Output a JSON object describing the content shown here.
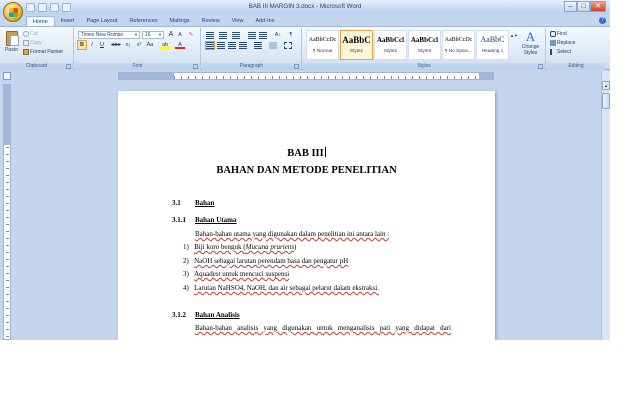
{
  "window": {
    "title": "BAB III MARGIN 3.docx - Microsoft Word",
    "controls": {
      "minimize": "–",
      "maximize": "□",
      "close": "✕"
    }
  },
  "tabs": [
    "Home",
    "Insert",
    "Page Layout",
    "References",
    "Mailings",
    "Review",
    "View",
    "Add-Ins"
  ],
  "ribbon": {
    "clipboard": {
      "paste": "Paste",
      "cut": "Cut",
      "copy": "Copy",
      "format_painter": "Format Painter",
      "label": "Clipboard"
    },
    "font": {
      "name": "Times New Roman",
      "size": "16",
      "grow": "A",
      "shrink": "A",
      "bold": "B",
      "italic": "I",
      "underline": "U",
      "strike": "abe",
      "subscript": "x₂",
      "superscript": "x²",
      "change_case": "Aa",
      "label": "Font"
    },
    "paragraph": {
      "label": "Paragraph",
      "sort": "A↓",
      "show_marks": "¶"
    },
    "styles": {
      "label": "Styles",
      "items": [
        {
          "sample": "AaBbCcDc",
          "name": "¶ Normal"
        },
        {
          "sample": "AaBbC",
          "name": "Style1"
        },
        {
          "sample": "AaBbCcl",
          "name": "Style2"
        },
        {
          "sample": "AaBbCcl",
          "name": "Style3"
        },
        {
          "sample": "AaBbCcDc",
          "name": "¶ No Spaci..."
        },
        {
          "sample": "AaBbC",
          "name": "Heading 1"
        }
      ],
      "change_styles": "Change Styles"
    },
    "editing": {
      "label": "Editing",
      "find": "Find",
      "replace": "Replace",
      "select": "Select"
    }
  },
  "document": {
    "title": "BAB III",
    "subtitle": "BAHAN DAN METODE  PENELITIAN",
    "s31_num": "3.1",
    "s31_title": "Bahan",
    "s311_num": "3.1.1",
    "s311_title": "Bahan Utama",
    "s311_intro": "Bahan-bahan utama yang digunakan dalam penelitian ini antara lain :",
    "list": [
      {
        "n": "1)",
        "pre": "Biji koro benguk (",
        "italic": "Mucuna pruriens",
        "post": ")"
      },
      {
        "n": "2)",
        "pre": "NaOH  sebagai larutan perendam basa dan pengatur pH",
        "italic": "",
        "post": ""
      },
      {
        "n": "3)",
        "pre": "Aquadest untuk mencuci suspensi",
        "italic": "",
        "post": ""
      },
      {
        "n": "4)",
        "pre": "Larutan NaHSO4, NaOH, dan air sebagai pelarut dalam ekstraksi.",
        "italic": "",
        "post": ""
      }
    ],
    "s312_num": "3.1.2",
    "s312_title": "Bahan Analisis",
    "s312_intro": "Bahan-bahan analisis yang digunakan untuk menganalisis pati yang didapat dari"
  }
}
